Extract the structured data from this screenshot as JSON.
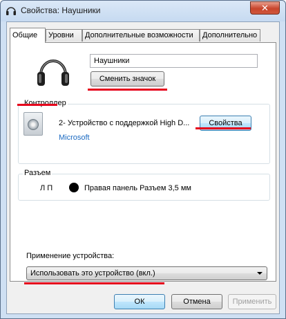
{
  "window": {
    "title": "Свойства: Наушники",
    "close_glyph": "✕"
  },
  "tabs": [
    {
      "label": "Общие",
      "active": true
    },
    {
      "label": "Уровни",
      "active": false
    },
    {
      "label": "Дополнительные возможности",
      "active": false
    },
    {
      "label": "Дополнительно",
      "active": false
    }
  ],
  "device": {
    "name": "Наушники",
    "change_icon_label": "Сменить значок"
  },
  "controller": {
    "label": "Контроллер",
    "name": "2- Устройство с поддержкой High D...",
    "manufacturer": "Microsoft",
    "properties_label": "Свойства"
  },
  "jack": {
    "label": "Разъем",
    "channels": "Л П",
    "description": "Правая панель Разъем 3,5 мм",
    "dot_color": "#000000"
  },
  "usage": {
    "label": "Применение устройства:",
    "selected": "Использовать это устройство (вкл.)"
  },
  "footer": {
    "ok_label": "ОК",
    "cancel_label": "Отмена",
    "apply_label": "Применить"
  },
  "colors": {
    "highlight_underline": "#e5001b",
    "manufacturer_link": "#1b6ac2"
  }
}
